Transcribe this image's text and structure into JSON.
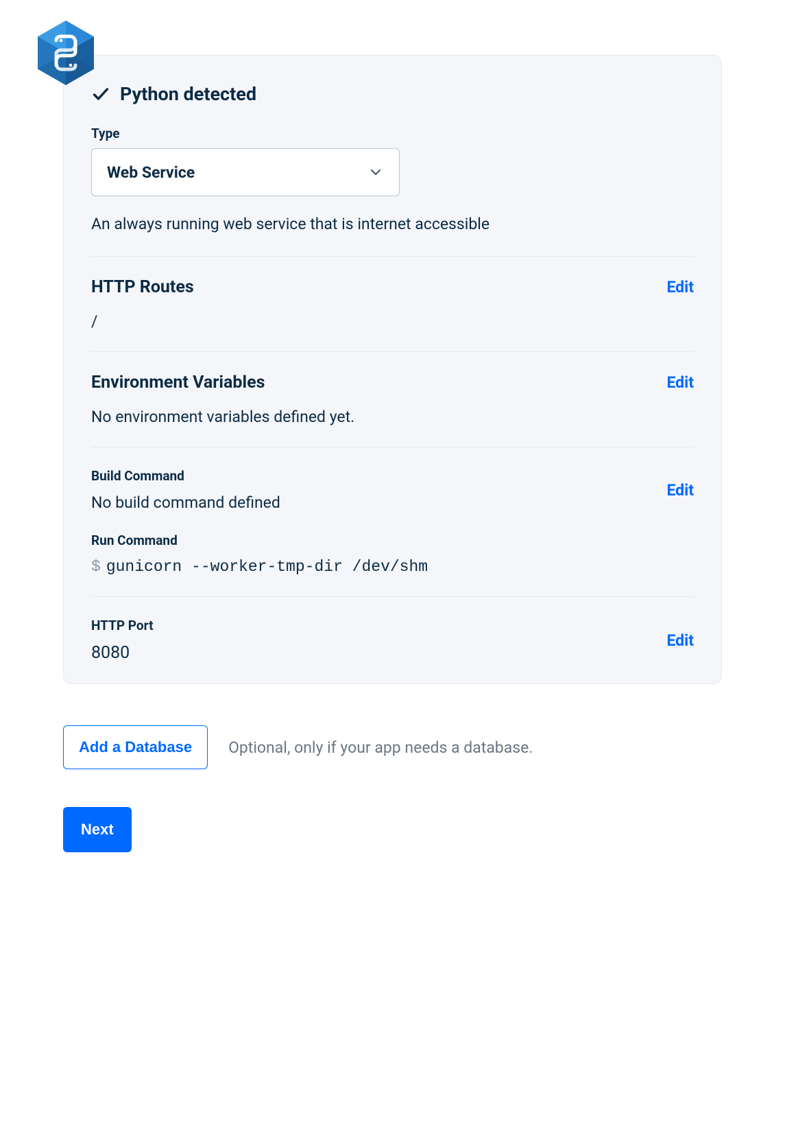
{
  "icon": "python-hex-icon",
  "detected": {
    "label": "Python detected"
  },
  "type": {
    "label": "Type",
    "selected": "Web Service",
    "description": "An always running web service that is internet accessible"
  },
  "http_routes": {
    "title": "HTTP Routes",
    "edit": "Edit",
    "value": "/"
  },
  "env_vars": {
    "title": "Environment Variables",
    "edit": "Edit",
    "value": "No environment variables defined yet."
  },
  "build_command": {
    "label": "Build Command",
    "edit": "Edit",
    "value": "No build command defined"
  },
  "run_command": {
    "label": "Run Command",
    "prompt": "$",
    "value": "gunicorn --worker-tmp-dir /dev/shm"
  },
  "http_port": {
    "label": "HTTP Port",
    "edit": "Edit",
    "value": "8080"
  },
  "add_database": {
    "button": "Add a Database",
    "hint": "Optional, only if your app needs a database."
  },
  "next": {
    "label": "Next"
  }
}
